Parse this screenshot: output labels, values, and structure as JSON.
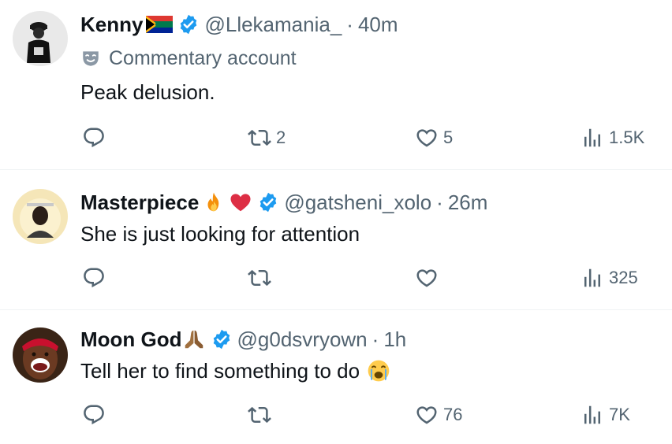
{
  "tweets": [
    {
      "name": "Kenny",
      "handle": "@Llekamania_",
      "separator": "·",
      "time": "40m",
      "label": "Commentary account",
      "text": "Peak delusion.",
      "replies": "",
      "reposts": "2",
      "likes": "5",
      "views": "1.5K",
      "name_emojis": [
        "south-africa-flag-icon"
      ],
      "text_emoji": ""
    },
    {
      "name": "Masterpiece",
      "handle": "@gatsheni_xolo",
      "separator": "·",
      "time": "26m",
      "text": "She is just looking for attention",
      "replies": "",
      "reposts": "",
      "likes": "",
      "views": "325",
      "name_emojis": [
        "fire-icon",
        "red-heart-icon"
      ],
      "text_emoji": ""
    },
    {
      "name": "Moon God",
      "handle": "@g0dsvryown",
      "separator": "·",
      "time": "1h",
      "text": "Tell her to find something to do",
      "replies": "",
      "reposts": "",
      "likes": "76",
      "views": "7K",
      "name_emojis": [
        "praying-hands-icon"
      ],
      "text_emoji": "loudly-crying-face-icon"
    }
  ],
  "colors": {
    "verified": "#1d9bf0",
    "muted": "#536471",
    "text": "#0f1419",
    "divider": "#eff3f4"
  }
}
